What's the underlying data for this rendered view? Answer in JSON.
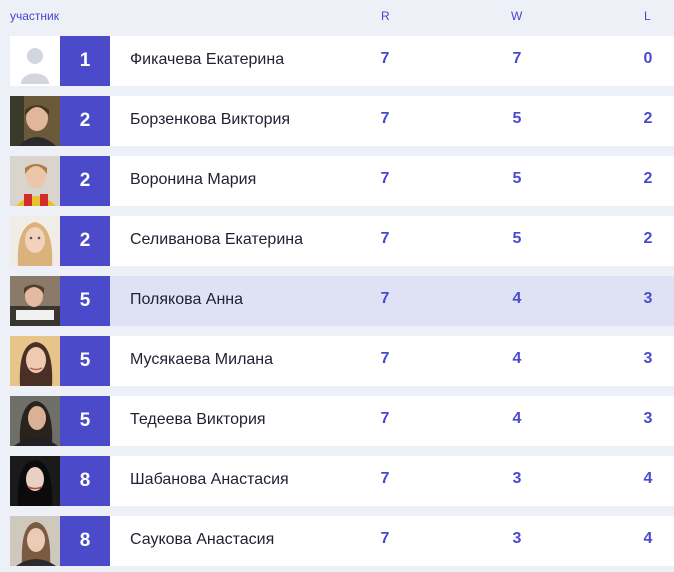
{
  "header": {
    "participant": "участник",
    "r": "R",
    "w": "W",
    "l": "L"
  },
  "rows": [
    {
      "rank": "1",
      "name": "Фикачева Екатерина",
      "r": "7",
      "w": "7",
      "l": "0",
      "avatar": "default-avatar-icon"
    },
    {
      "rank": "2",
      "name": "Борзенкова Виктория",
      "r": "7",
      "w": "5",
      "l": "2",
      "avatar": "player-photo"
    },
    {
      "rank": "2",
      "name": "Воронина Мария",
      "r": "7",
      "w": "5",
      "l": "2",
      "avatar": "player-photo"
    },
    {
      "rank": "2",
      "name": "Селиванова Екатерина",
      "r": "7",
      "w": "5",
      "l": "2",
      "avatar": "player-photo"
    },
    {
      "rank": "5",
      "name": "Полякова Анна",
      "r": "7",
      "w": "4",
      "l": "3",
      "avatar": "player-photo",
      "highlighted": true
    },
    {
      "rank": "5",
      "name": "Мусякаева Милана",
      "r": "7",
      "w": "4",
      "l": "3",
      "avatar": "player-photo"
    },
    {
      "rank": "5",
      "name": "Тедеева Виктория",
      "r": "7",
      "w": "4",
      "l": "3",
      "avatar": "player-photo"
    },
    {
      "rank": "8",
      "name": "Шабанова Анастасия",
      "r": "7",
      "w": "3",
      "l": "4",
      "avatar": "player-photo"
    },
    {
      "rank": "8",
      "name": "Саукова Анастасия",
      "r": "7",
      "w": "3",
      "l": "4",
      "avatar": "player-photo"
    }
  ],
  "colors": {
    "accent": "#4a4acb",
    "stat_text": "#4a4ad1",
    "highlight_row": "#dfe2f4",
    "page_bg": "#eef0f7"
  }
}
